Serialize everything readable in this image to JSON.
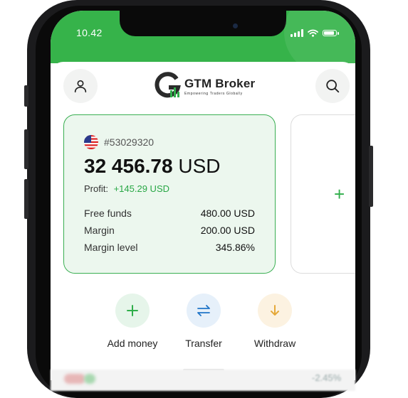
{
  "status_bar": {
    "time": "10.42"
  },
  "brand": {
    "name": "GTM Broker",
    "tagline": "Empowering Traders Globally",
    "accent_color": "#36b34a"
  },
  "header": {
    "user_icon": "user-icon",
    "search_icon": "search-icon"
  },
  "account_card": {
    "flag": "us-flag-icon",
    "account_number": "#53029320",
    "balance_value": "32 456.78",
    "balance_currency": "USD",
    "profit_label": "Profit:",
    "profit_value": "+145.29 USD",
    "details": [
      {
        "label": "Free funds",
        "value": "480.00 USD"
      },
      {
        "label": "Margin",
        "value": "200.00 USD"
      },
      {
        "label": "Margin level",
        "value": "345.86%"
      }
    ]
  },
  "add_account_card": {
    "icon": "plus-icon"
  },
  "actions": [
    {
      "label": "Add money",
      "icon": "plus-icon",
      "color": "#2fae4a",
      "bg": "#e6f5ea"
    },
    {
      "label": "Transfer",
      "icon": "transfer-arrows-icon",
      "color": "#1f74c8",
      "bg": "#e6f0fa"
    },
    {
      "label": "Withdraw",
      "icon": "arrow-down-icon",
      "color": "#e5a93a",
      "bg": "#fcf2e1"
    }
  ],
  "background_row": {
    "change_value": "-2.45%"
  }
}
